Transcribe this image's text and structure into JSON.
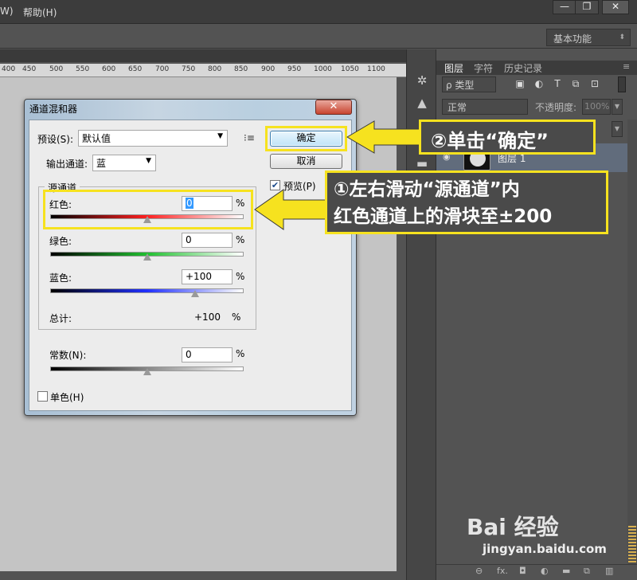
{
  "menubar": {
    "items": [
      "W)",
      "帮助(H)"
    ],
    "win_buttons": [
      "—",
      "❐",
      "✕"
    ]
  },
  "optbar": {
    "workspace": "基本功能"
  },
  "ruler": {
    "ticks": [
      "400",
      "450",
      "500",
      "550",
      "600",
      "650",
      "700",
      "750",
      "800",
      "850",
      "900",
      "950",
      "1000",
      "1050",
      "1100"
    ]
  },
  "panel": {
    "tabs": [
      "图层",
      "字符",
      "历史记录"
    ],
    "filter_label": "ρ 类型",
    "blend_mode": "正常",
    "opacity_label": "不透明度:",
    "opacity_value": "100%",
    "layer_name": "图层 1"
  },
  "dialog": {
    "title": "通道混和器",
    "close": "✕",
    "preset_label": "预设(S):",
    "preset_value": "默认值",
    "output_label": "输出通道:",
    "output_value": "蓝",
    "ok": "确定",
    "cancel": "取消",
    "preview_label": "预览(P)",
    "source_group": "源通道",
    "red_label": "红色:",
    "red_value": "0",
    "green_label": "绿色:",
    "green_value": "0",
    "blue_label": "蓝色:",
    "blue_value": "+100",
    "total_label": "总计:",
    "total_value": "+100",
    "percent": "%",
    "constant_label": "常数(N):",
    "constant_value": "0",
    "mono_label": "单色(H)",
    "sliders": {
      "red": 0,
      "green": 0,
      "blue": 100,
      "constant": 0,
      "range": [
        -200,
        200
      ]
    }
  },
  "callouts": {
    "step2": "②单击“确定”",
    "step1_line1": "①左右滑动“源通道”内",
    "step1_line2": "红色通道上的滑块至±200"
  },
  "watermark": {
    "brand": "Bai 经验",
    "url": "jingyan.baidu.com"
  },
  "colors": {
    "highlight": "#f6e21f",
    "callout_bg": "#4a4a4a"
  }
}
